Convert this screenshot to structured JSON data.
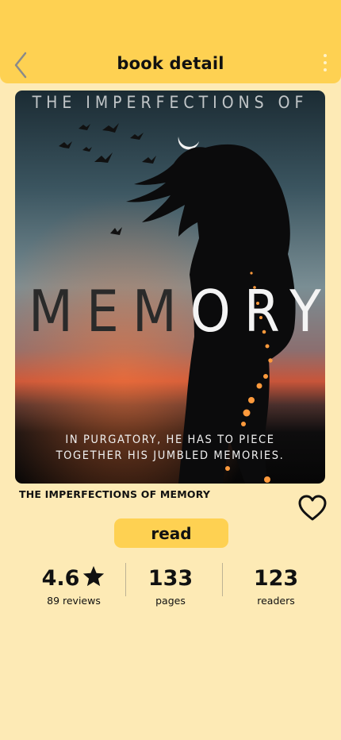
{
  "header": {
    "title": "book detail",
    "back_icon": "chevron-left-icon",
    "more_icon": "kebab-menu-icon",
    "background_color": "#fed152"
  },
  "book": {
    "cover": {
      "top_text": "THE IMPERFECTIONS OF",
      "title_dark": "MEM",
      "title_light": "ORY",
      "tagline_line1": "IN PURGATORY, HE HAS TO PIECE",
      "tagline_line2": "TOGETHER HIS JUMBLED MEMORIES."
    },
    "title": "THE IMPERFECTIONS OF MEMORY",
    "favorite_icon": "heart-outline-icon"
  },
  "actions": {
    "read_label": "read",
    "accent_color": "#fed152"
  },
  "stats": {
    "rating": {
      "value": "4.6",
      "label": "89 reviews",
      "icon": "star-icon"
    },
    "pages": {
      "value": "133",
      "label": "pages"
    },
    "readers": {
      "value": "123",
      "label": "readers"
    }
  },
  "page_background": "#fdeab5"
}
